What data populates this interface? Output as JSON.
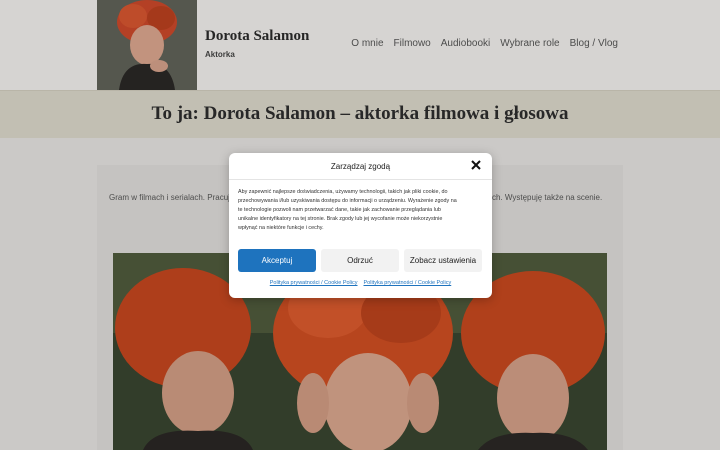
{
  "site": {
    "title": "Dorota Salamon",
    "subtitle": "Aktorka"
  },
  "nav": {
    "items": [
      "O mnie",
      "Filmowo",
      "Audiobooki",
      "Wybrane role",
      "Blog / Vlog"
    ]
  },
  "page": {
    "title": "To ja: Dorota Salamon – aktorka filmowa i głosowa",
    "intro_left": "Gram w filmach i serialach. Pracuj",
    "intro_right": "ch. Występuję także na scenie."
  },
  "consent": {
    "title": "Zarządzaj zgodą",
    "body": "Aby zapewnić najlepsze doświadczenia, używamy technologii, takich jak pliki cookie, do przechowywania i/lub uzyskiwania dostępu do informacji o urządzeniu. Wyrażenie zgody na te technologie pozwoli nam przetwarzać dane, takie jak zachowanie przeglądania lub unikalne identyfikatory na tej stronie. Brak zgody lub jej wycofanie może niekorzystnie wpłynąć na niektóre funkcje i cechy.",
    "accept_label": "Akceptuj",
    "deny_label": "Odrzuć",
    "settings_label": "Zobacz ustawienia",
    "links": [
      "Polityka prywatności / Cookie Policy",
      "Polityka prywatności / Cookie Policy"
    ],
    "accent_color": "#1e73be"
  }
}
